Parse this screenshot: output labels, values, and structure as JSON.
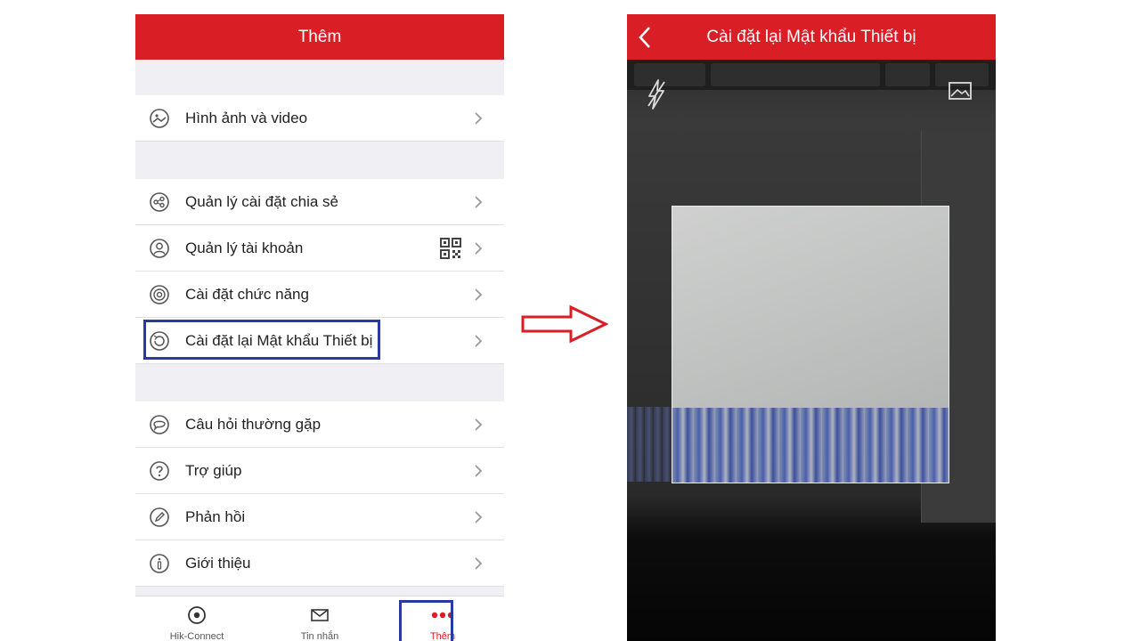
{
  "left_screen": {
    "title": "Thêm",
    "menu": [
      {
        "icon": "photo-video-icon",
        "label": "Hình ảnh và video"
      },
      {
        "icon": "share-settings-icon",
        "label": "Quản lý cài đặt chia sẻ"
      },
      {
        "icon": "account-icon",
        "label": "Quản lý tài khoản",
        "extra_icon": "qr-code-icon"
      },
      {
        "icon": "function-settings-icon",
        "label": "Cài đặt chức năng"
      },
      {
        "icon": "reset-password-icon",
        "label": "Cài đặt lại Mật khẩu Thiết bị",
        "highlighted": true
      },
      {
        "icon": "faq-icon",
        "label": "Câu hỏi thường gặp"
      },
      {
        "icon": "help-icon",
        "label": "Trợ giúp"
      },
      {
        "icon": "feedback-icon",
        "label": "Phản hồi"
      },
      {
        "icon": "about-icon",
        "label": "Giới thiệu"
      }
    ],
    "tabs": [
      {
        "icon": "hik-connect-icon",
        "label": "Hik-Connect"
      },
      {
        "icon": "message-icon",
        "label": "Tin nhắn"
      },
      {
        "icon": "more-icon",
        "label": "Thêm",
        "active": true
      }
    ]
  },
  "right_screen": {
    "title": "Cài đặt lại Mật khẩu Thiết bị",
    "icons": [
      "back-icon",
      "flash-off-icon",
      "gallery-icon"
    ]
  },
  "colors": {
    "header_red": "#d91e25",
    "highlight_blue": "#2a3aa0",
    "arrow_red": "#d91e25"
  }
}
